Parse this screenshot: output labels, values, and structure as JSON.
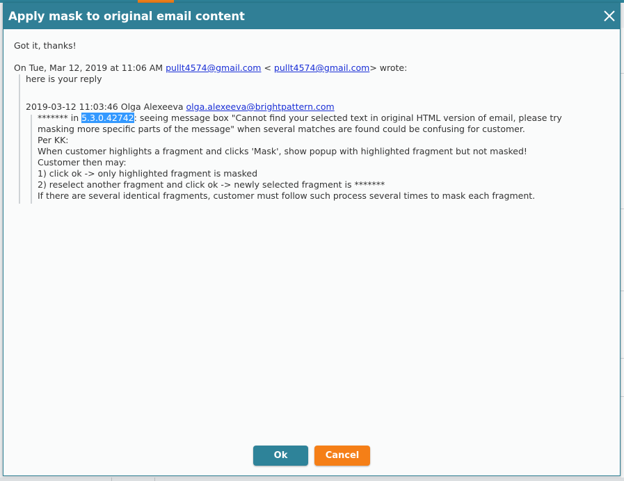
{
  "dialog": {
    "title": "Apply mask to original email content",
    "close_icon": "close-icon",
    "colors": {
      "titlebar": "#307f96",
      "ok_button": "#2e8399",
      "cancel_button": "#f57f17",
      "highlight": "#3399ff",
      "link": "#1a2fd6"
    }
  },
  "email": {
    "line1": "Got it, thanks!",
    "reply_header_prefix": "On Tue, Mar 12, 2019 at 11:06 AM ",
    "reply_header_email1": "pullt4574@gmail.com",
    "reply_header_mid": " < ",
    "reply_header_email2": "pullt4574@gmail.com",
    "reply_header_suffix": "> wrote:",
    "quoted_reply": "here is your reply",
    "nested_header_prefix": "2019-03-12 11:03:46 Olga Alexeeva ",
    "nested_header_email": "olga.alexeeva@brightpattern.com",
    "body_prefix": "******* in ",
    "body_highlight": "5.3.0.42742",
    "body_line1_rest": ": seeing message box \"Cannot find your selected text in original HTML version of email, please try",
    "body_line2": "masking more specific parts of the message\" when several matches are found could be confusing for customer.",
    "body_line3": "Per KK:",
    "body_line4": "When customer highlights a fragment and clicks 'Mask', show popup with highlighted fragment but not masked!",
    "body_line5": "Customer then may:",
    "body_line6": "1) click ok -> only highlighted fragment is masked",
    "body_line7": "2) reselect another fragment and click ok -> newly selected fragment is *******",
    "body_line8": "If there are several identical fragments, customer must follow such process several times to mask each fragment."
  },
  "buttons": {
    "ok_label": "Ok",
    "cancel_label": "Cancel"
  }
}
